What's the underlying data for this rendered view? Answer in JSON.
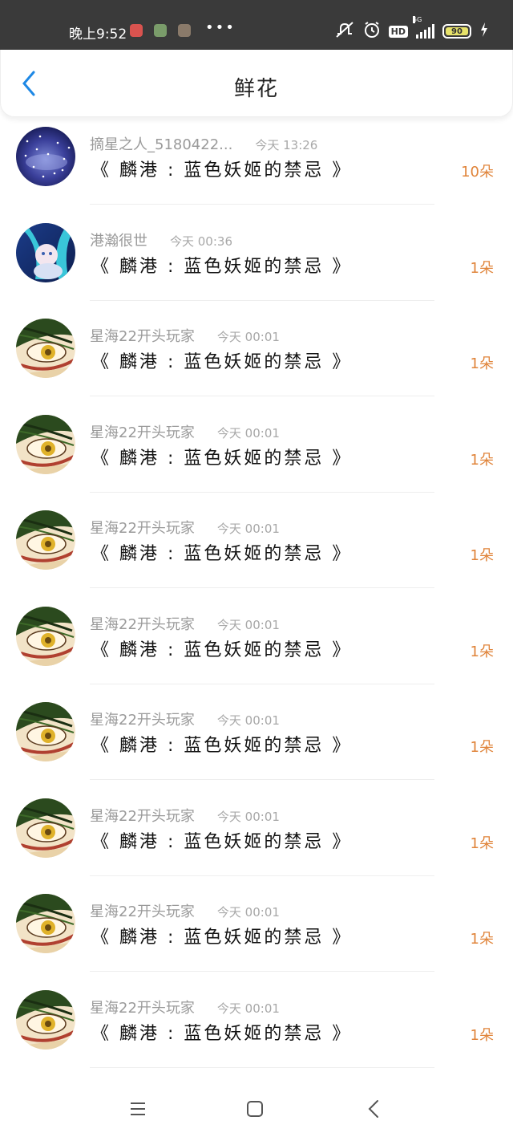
{
  "status_bar": {
    "time": "晚上9:52",
    "more": "•••",
    "hd": "HD",
    "network": "5G",
    "battery_level": "90"
  },
  "header": {
    "title": "鲜花",
    "back_icon": "chevron-left-icon"
  },
  "entries": [
    {
      "user": "摘星之人_5180422...",
      "time": "今天 13:26",
      "book": "《 麟港 : 蓝色妖姬的禁忌 》",
      "count": "10朵",
      "avatar": "galaxy"
    },
    {
      "user": "港瀚很世",
      "time": "今天 00:36",
      "book": "《 麟港 : 蓝色妖姬的禁忌 》",
      "count": "1朵",
      "avatar": "anime"
    },
    {
      "user": "星海22开头玩家",
      "time": "今天 00:01",
      "book": "《 麟港 : 蓝色妖姬的禁忌 》",
      "count": "1朵",
      "avatar": "eye"
    },
    {
      "user": "星海22开头玩家",
      "time": "今天 00:01",
      "book": "《 麟港 : 蓝色妖姬的禁忌 》",
      "count": "1朵",
      "avatar": "eye"
    },
    {
      "user": "星海22开头玩家",
      "time": "今天 00:01",
      "book": "《 麟港 : 蓝色妖姬的禁忌 》",
      "count": "1朵",
      "avatar": "eye"
    },
    {
      "user": "星海22开头玩家",
      "time": "今天 00:01",
      "book": "《 麟港 : 蓝色妖姬的禁忌 》",
      "count": "1朵",
      "avatar": "eye"
    },
    {
      "user": "星海22开头玩家",
      "time": "今天 00:01",
      "book": "《 麟港 : 蓝色妖姬的禁忌 》",
      "count": "1朵",
      "avatar": "eye"
    },
    {
      "user": "星海22开头玩家",
      "time": "今天 00:01",
      "book": "《 麟港 : 蓝色妖姬的禁忌 》",
      "count": "1朵",
      "avatar": "eye"
    },
    {
      "user": "星海22开头玩家",
      "time": "今天 00:01",
      "book": "《 麟港 : 蓝色妖姬的禁忌 》",
      "count": "1朵",
      "avatar": "eye"
    },
    {
      "user": "星海22开头玩家",
      "time": "今天 00:01",
      "book": "《 麟港 : 蓝色妖姬的禁忌 》",
      "count": "1朵",
      "avatar": "eye"
    }
  ],
  "colors": {
    "accent": "#1e88e5",
    "count": "#e0843a",
    "status_bar": "#3a3a3a"
  },
  "nav": {
    "menu_icon": "menu-icon",
    "home_icon": "home-square-icon",
    "back_icon": "back-triangle-icon"
  }
}
